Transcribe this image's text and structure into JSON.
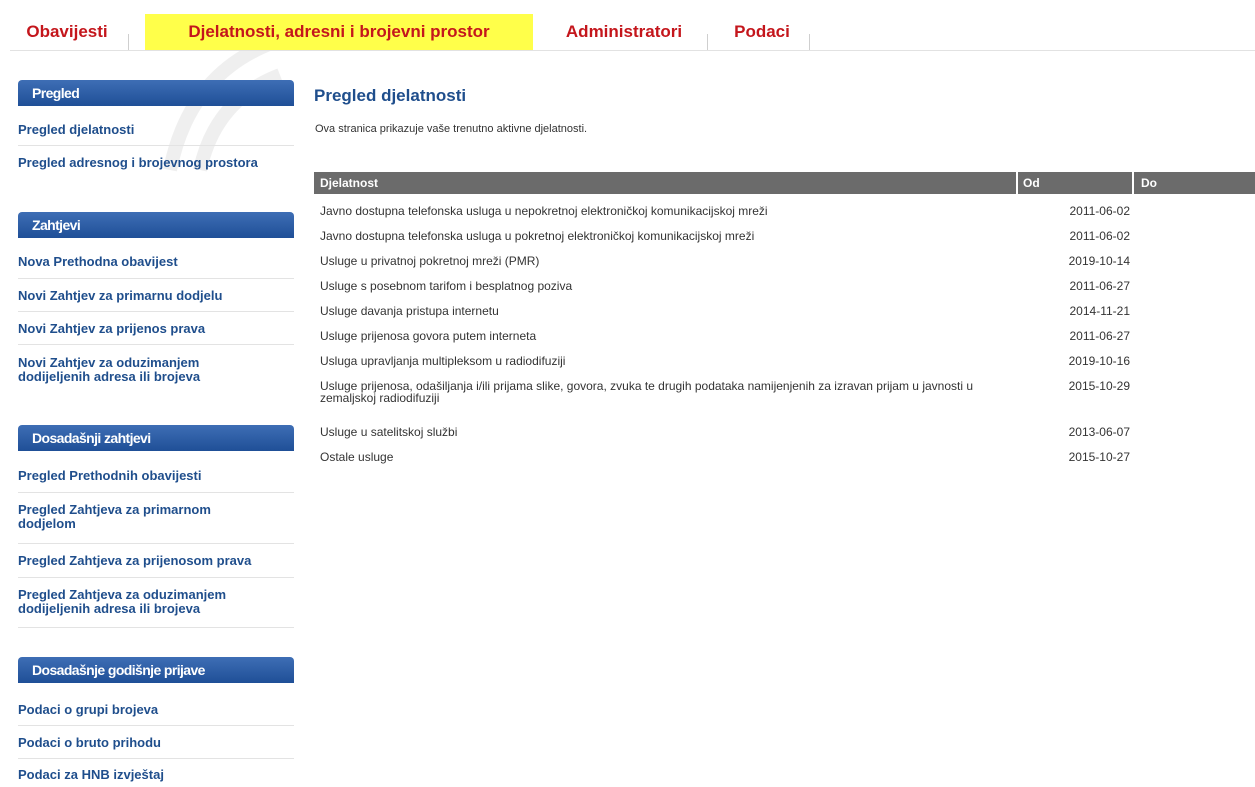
{
  "nav": {
    "tabs": [
      {
        "label": "Obavijesti",
        "active": false
      },
      {
        "label": "Djelatnosti, adresni i brojevni prostor",
        "active": true
      },
      {
        "label": "Administratori",
        "active": false
      },
      {
        "label": "Podaci",
        "active": false
      }
    ]
  },
  "sidebar": {
    "sections": [
      {
        "title": "Pregled",
        "items": [
          "Pregled djelatnosti",
          "Pregled adresnog i brojevnog prostora"
        ]
      },
      {
        "title": "Zahtjevi",
        "items": [
          "Nova Prethodna obavijest",
          "Novi Zahtjev za primarnu dodjelu",
          "Novi Zahtjev za prijenos prava",
          "Novi Zahtjev za oduzimanjem dodijeljenih adresa ili brojeva"
        ]
      },
      {
        "title": "Dosadašnji zahtjevi",
        "items": [
          "Pregled Prethodnih obavijesti",
          "Pregled Zahtjeva za primarnom dodjelom",
          "Pregled Zahtjeva za prijenosom prava",
          "Pregled Zahtjeva za oduzimanjem dodijeljenih adresa ili brojeva"
        ]
      },
      {
        "title": "Dosadašnje godišnje prijave",
        "items": [
          "Podaci o grupi brojeva",
          "Podaci o bruto prihodu",
          "Podaci za HNB izvještaj"
        ]
      }
    ]
  },
  "main": {
    "title": "Pregled djelatnosti",
    "description": "Ova stranica prikazuje vaše trenutno aktivne djelatnosti.",
    "table": {
      "columns": [
        "Djelatnost",
        "Od",
        "Do"
      ],
      "rows": [
        {
          "name": "Javno dostupna telefonska usluga u nepokretnoj elektroničkoj komunikacijskoj mreži",
          "od": "2011-06-02",
          "do": ""
        },
        {
          "name": "Javno dostupna telefonska usluga u pokretnoj elektroničkoj komunikacijskoj mreži",
          "od": "2011-06-02",
          "do": ""
        },
        {
          "name": "Usluge u privatnoj pokretnoj mreži (PMR)",
          "od": "2019-10-14",
          "do": ""
        },
        {
          "name": "Usluge s posebnom tarifom i besplatnog poziva",
          "od": "2011-06-27",
          "do": ""
        },
        {
          "name": "Usluge davanja pristupa internetu",
          "od": "2014-11-21",
          "do": ""
        },
        {
          "name": "Usluge prijenosa govora putem interneta",
          "od": "2011-06-27",
          "do": ""
        },
        {
          "name": "Usluga upravljanja multipleksom u radiodifuziji",
          "od": "2019-10-16",
          "do": ""
        },
        {
          "name": "Usluge prijenosa, odašiljanja i/ili prijama slike, govora, zvuka te drugih podataka namijenjenih za izravan prijam u javnosti u zemaljskoj radiodifuziji",
          "od": "2015-10-29",
          "do": ""
        },
        {
          "name": "Usluge u satelitskoj službi",
          "od": "2013-06-07",
          "do": ""
        },
        {
          "name": "Ostale usluge",
          "od": "2015-10-27",
          "do": ""
        }
      ]
    }
  }
}
